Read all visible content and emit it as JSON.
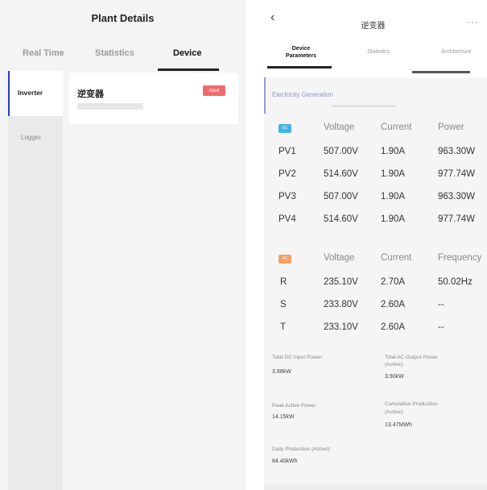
{
  "left": {
    "title": "Plant Details",
    "tabs": [
      {
        "label": "Real Time"
      },
      {
        "label": "Statistics"
      },
      {
        "label": "Device"
      }
    ],
    "sidebar": [
      {
        "label": "Inverter"
      },
      {
        "label": "Logger"
      }
    ],
    "device": {
      "name": "逆变器",
      "status": "Alert",
      "status_color": "#ef6b6b"
    }
  },
  "right": {
    "title": "逆变器",
    "back_icon": "chevron-left-icon",
    "more_icon": "more-dots-icon",
    "tabs": [
      {
        "line1": "Device",
        "line2": "Parameters"
      },
      {
        "label": "Statistics"
      },
      {
        "label": "Architecture"
      }
    ],
    "section_title": "Electricity Generation",
    "dc": {
      "badge": "DC",
      "badge_color": "#3fb4e6",
      "headers": [
        "Voltage",
        "Current",
        "Power"
      ],
      "rows": [
        {
          "name": "PV1",
          "voltage": "507.00V",
          "current": "1.90A",
          "power": "963.30W"
        },
        {
          "name": "PV2",
          "voltage": "514.60V",
          "current": "1.90A",
          "power": "977.74W"
        },
        {
          "name": "PV3",
          "voltage": "507.00V",
          "current": "1.90A",
          "power": "963.30W"
        },
        {
          "name": "PV4",
          "voltage": "514.60V",
          "current": "1.90A",
          "power": "977.74W"
        }
      ]
    },
    "ac": {
      "badge": "AC",
      "badge_color": "#f3a063",
      "headers": [
        "Voltage",
        "Current",
        "Frequency"
      ],
      "rows": [
        {
          "name": "R",
          "voltage": "235.10V",
          "current": "2.70A",
          "freq": "50.02Hz"
        },
        {
          "name": "S",
          "voltage": "233.80V",
          "current": "2.60A",
          "freq": "--"
        },
        {
          "name": "T",
          "voltage": "233.10V",
          "current": "2.60A",
          "freq": "--"
        }
      ]
    },
    "summary": {
      "total_dc_label": "Total DC Input Power:",
      "total_dc_value": "3.88kW",
      "total_ac_label1": "Total AC Output Power",
      "total_ac_label2": "(Active):",
      "total_ac_value": "3.90kW",
      "peak_label": "Peak Active Power:",
      "peak_value": "14.15kW",
      "cum_label1": "Cumulative Production",
      "cum_label2": "(Active):",
      "cum_value": "13.47MWh",
      "daily_label": "Daily Production (Active):",
      "daily_value": "84.40kWh"
    }
  }
}
